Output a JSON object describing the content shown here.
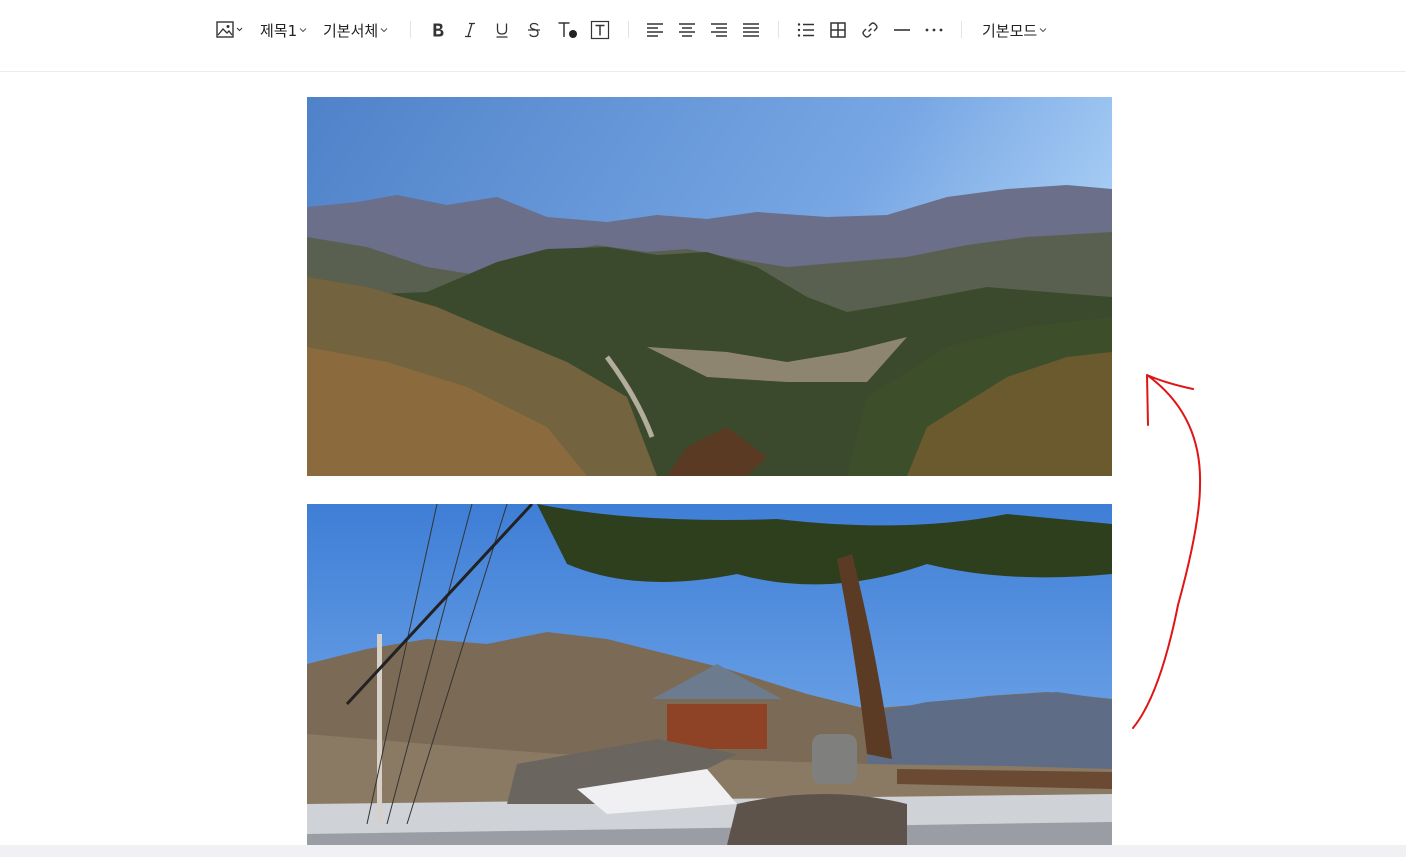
{
  "toolbar": {
    "image_button": {
      "icon": "image-icon"
    },
    "heading_select": {
      "label": "제목1"
    },
    "font_select": {
      "label": "기본서체"
    },
    "format_buttons": [
      {
        "name": "bold-icon"
      },
      {
        "name": "italic-icon"
      },
      {
        "name": "underline-icon"
      },
      {
        "name": "strikethrough-icon"
      },
      {
        "name": "text-color-icon"
      },
      {
        "name": "text-background-icon"
      }
    ],
    "align_buttons": [
      {
        "name": "align-left-icon"
      },
      {
        "name": "align-center-icon"
      },
      {
        "name": "align-right-icon"
      },
      {
        "name": "align-justify-icon"
      }
    ],
    "insert_buttons": [
      {
        "name": "list-icon"
      },
      {
        "name": "table-icon"
      },
      {
        "name": "link-icon"
      },
      {
        "name": "horizontal-rule-icon"
      },
      {
        "name": "more-icon"
      }
    ],
    "mode_select": {
      "label": "기본모드"
    }
  },
  "content": {
    "images": [
      {
        "description": "mountain-valley-landscape"
      },
      {
        "description": "pine-tree-and-pavilion-observation-deck"
      }
    ],
    "annotation": {
      "type": "hand-drawn-arrow",
      "color": "#e01515"
    }
  },
  "colors": {
    "annotation": "#e01515",
    "border": "#ececec",
    "bottom_bar": "#f1f1f3"
  }
}
